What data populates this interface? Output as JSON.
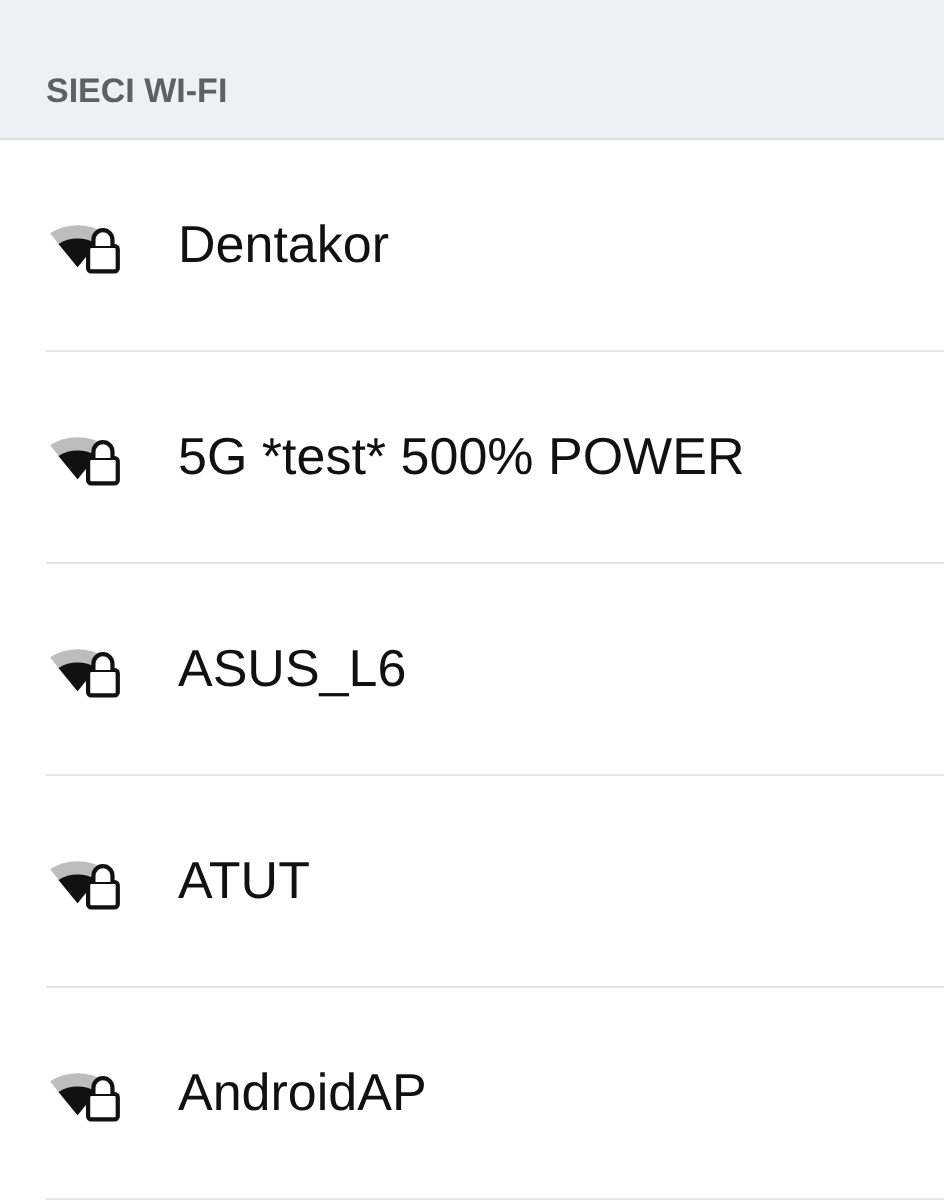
{
  "section": {
    "title": "SIECI WI-FI"
  },
  "networks": [
    {
      "name": "Dentakor",
      "secured": true
    },
    {
      "name": "5G *test* 500% POWER",
      "secured": true
    },
    {
      "name": "ASUS_L6",
      "secured": true
    },
    {
      "name": "ATUT",
      "secured": true
    },
    {
      "name": "AndroidAP",
      "secured": true
    }
  ]
}
